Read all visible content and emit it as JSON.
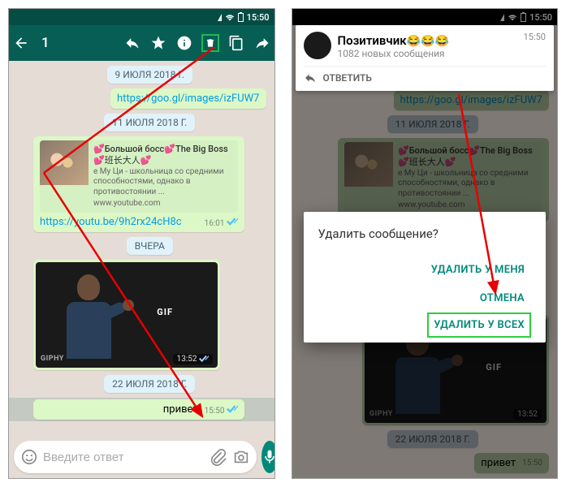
{
  "status": {
    "time": "15:50"
  },
  "toolbar": {
    "selected": "1"
  },
  "left": {
    "dates": [
      "9 ИЮЛЯ 2018 Г.",
      "11 ИЮЛЯ 2018 Г.",
      "ВЧЕРА",
      "22 ИЮЛЯ 2018 Г."
    ],
    "link1": "https://goo.gl/images/izFUW7",
    "preview": {
      "title": "💕Большой босс💕The Big Boss💕班长大人💕",
      "desc": "е Му Ци - школьница со средними способностями, однако в противостоянии ...",
      "source": "www.youtube.com"
    },
    "link2": "https://youtu.be/9h2rx24cH8c",
    "link2_time": "16:01",
    "gif": {
      "label": "GIF",
      "brand": "GIPHY",
      "time": "13:52"
    },
    "hi": "привет",
    "hi_time": "15:50",
    "input_placeholder": "Введите ответ"
  },
  "right": {
    "notif": {
      "title": "Позитивчик",
      "emoji": "😂😂😂",
      "sub": "1082 новых сообщения",
      "time": "15:50",
      "reply": "ОТВЕТИТЬ"
    },
    "link1": "https://goo.gl/images/izFUW7",
    "date1": "11 ИЮЛЯ 2018 Г.",
    "date2": "22 ИЮЛЯ 2018 Г.",
    "dialog": {
      "title": "Удалить сообщение?",
      "del_me": "УДАЛИТЬ У МЕНЯ",
      "cancel": "ОТМЕНА",
      "del_all": "УДАЛИТЬ У ВСЕХ"
    }
  }
}
